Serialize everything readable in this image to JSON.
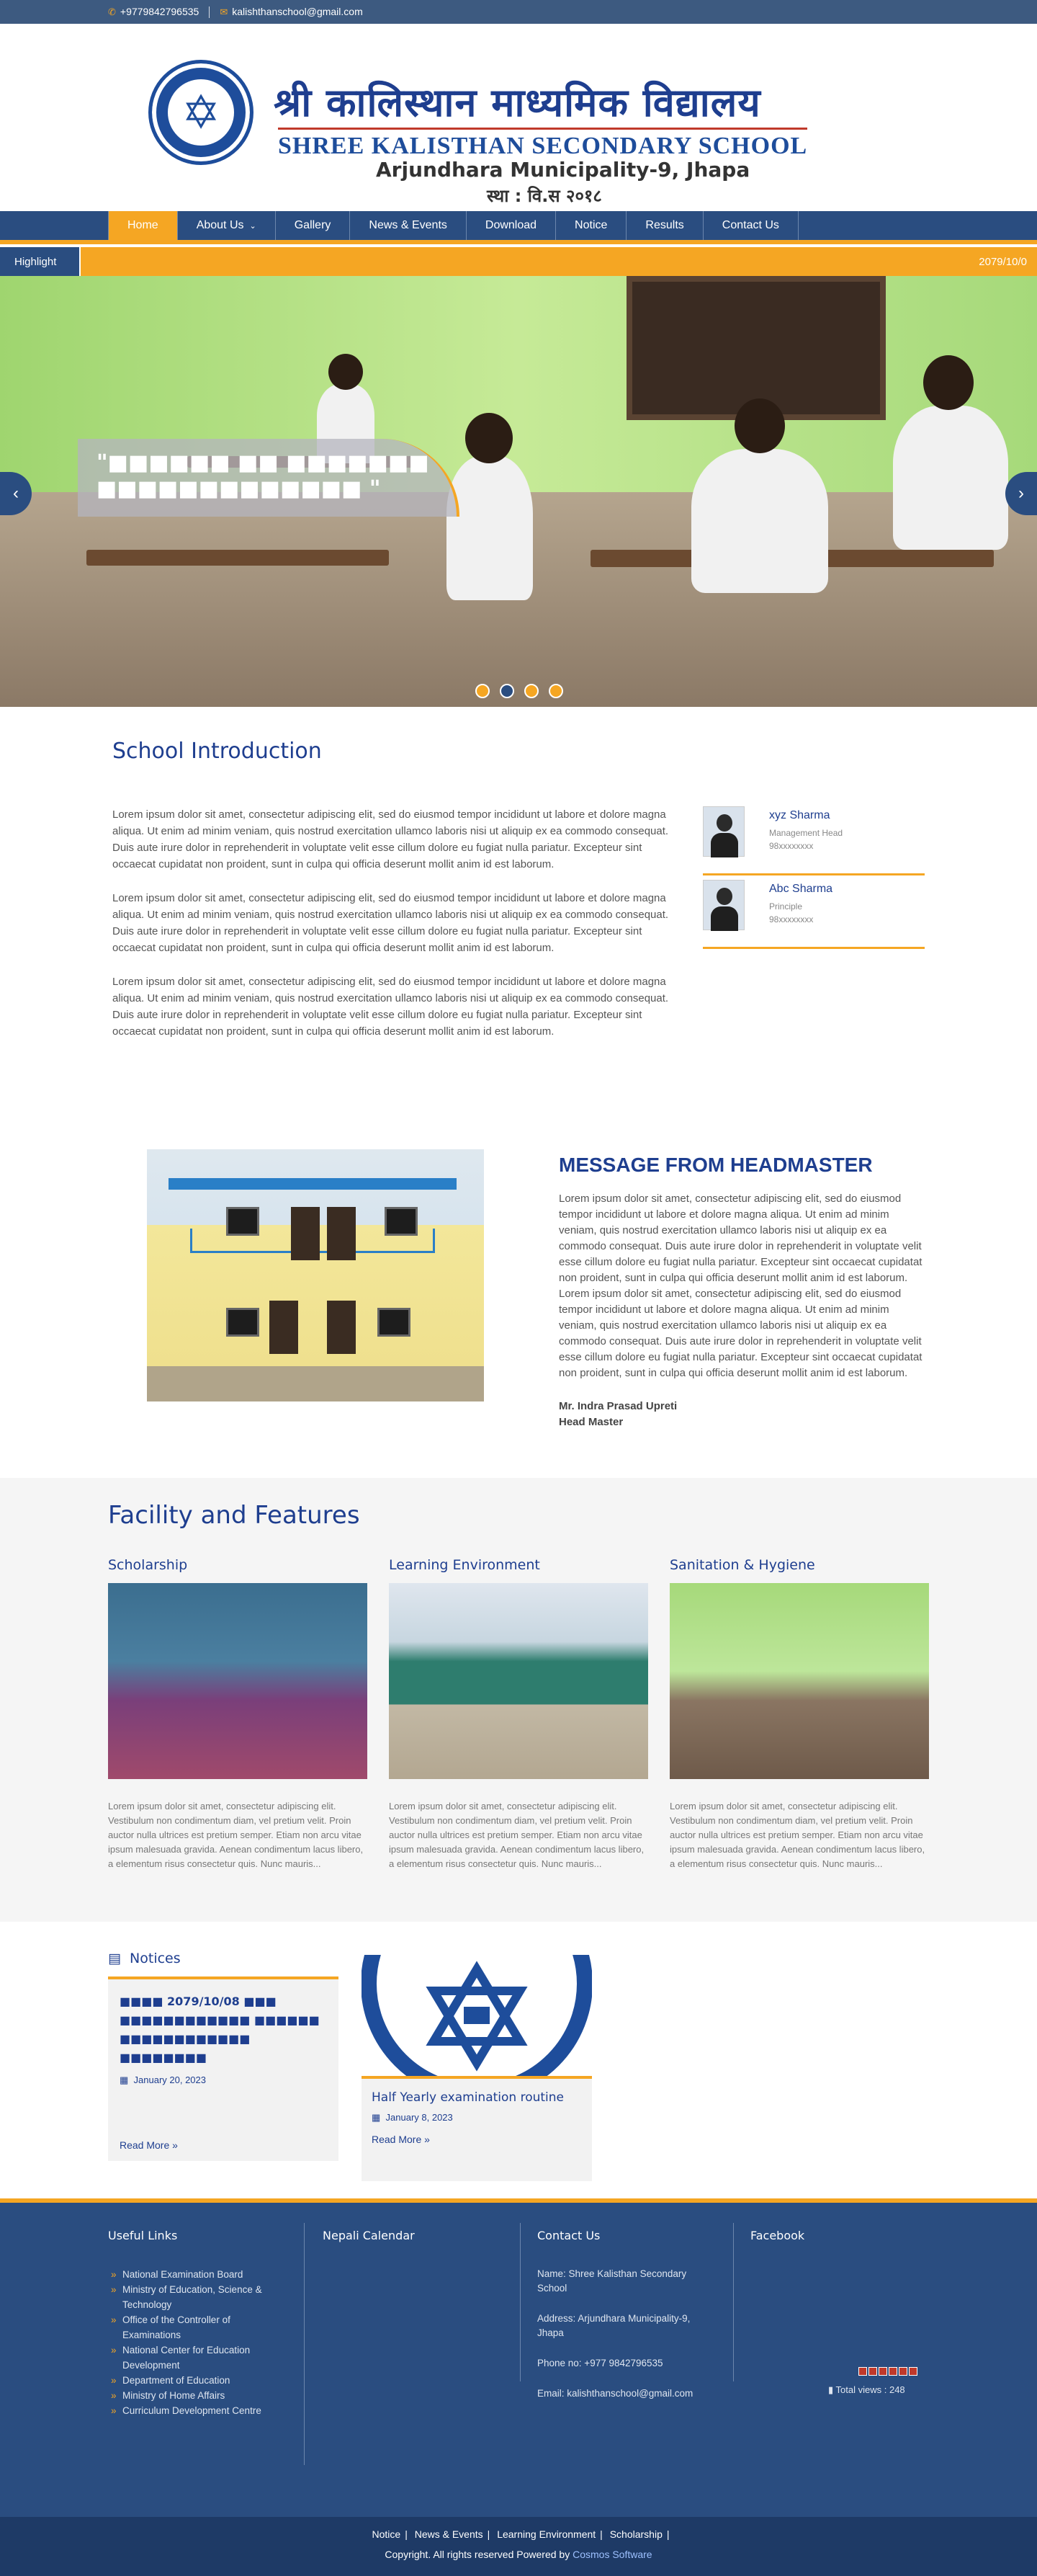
{
  "topbar": {
    "phone": "+9779842796535",
    "email": "kalishthanschool@gmail.com"
  },
  "header": {
    "name_np": "श्री कालिस्थान माध्यमिक विद्यालय",
    "name_en": "SHREE KALISTHAN SECONDARY SCHOOL",
    "address": "Arjundhara Municipality-9, Jhapa",
    "established": "स्था : वि.स २०१८"
  },
  "nav": {
    "items": [
      "Home",
      "About Us",
      "Gallery",
      "News & Events",
      "Download",
      "Notice",
      "Results",
      "Contact Us"
    ],
    "active": "Home"
  },
  "highlight": {
    "label": "Highlight",
    "text": "2079/10/0"
  },
  "slider": {
    "caption": "\"■■■■■■ ■■ ■■■■■■■ ■■■■■■■■■■■■■ \""
  },
  "intro": {
    "title": "School Introduction",
    "paragraphs": [
      "Lorem ipsum dolor sit amet, consectetur adipiscing elit, sed do eiusmod tempor incididunt ut labore et dolore magna aliqua. Ut enim ad minim veniam, quis nostrud exercitation ullamco laboris nisi ut aliquip ex ea commodo consequat. Duis aute irure dolor in reprehenderit in voluptate velit esse cillum dolore eu fugiat nulla pariatur. Excepteur sint occaecat cupidatat non proident, sunt in culpa qui officia deserunt mollit anim id est laborum.",
      "Lorem ipsum dolor sit amet, consectetur adipiscing elit, sed do eiusmod tempor incididunt ut labore et dolore magna aliqua. Ut enim ad minim veniam, quis nostrud exercitation ullamco laboris nisi ut aliquip ex ea commodo consequat. Duis aute irure dolor in reprehenderit in voluptate velit esse cillum dolore eu fugiat nulla pariatur. Excepteur sint occaecat cupidatat non proident, sunt in culpa qui officia deserunt mollit anim id est laborum.",
      "Lorem ipsum dolor sit amet, consectetur adipiscing elit, sed do eiusmod tempor incididunt ut labore et dolore magna aliqua. Ut enim ad minim veniam, quis nostrud exercitation ullamco laboris nisi ut aliquip ex ea commodo consequat. Duis aute irure dolor in reprehenderit in voluptate velit esse cillum dolore eu fugiat nulla pariatur. Excepteur sint occaecat cupidatat non proident, sunt in culpa qui officia deserunt mollit anim id est laborum."
    ],
    "staff": [
      {
        "name": "xyz Sharma",
        "role": "Management Head",
        "phone": "98xxxxxxxx"
      },
      {
        "name": "Abc Sharma",
        "role": "Principle",
        "phone": "98xxxxxxxx"
      }
    ]
  },
  "headmaster": {
    "title": "MESSAGE FROM HEADMASTER",
    "text": "Lorem ipsum dolor sit amet, consectetur adipiscing elit, sed do eiusmod tempor incididunt ut labore et dolore magna aliqua. Ut enim ad minim veniam, quis nostrud exercitation ullamco laboris nisi ut aliquip ex ea commodo consequat. Duis aute irure dolor in reprehenderit in voluptate velit esse cillum dolore eu fugiat nulla pariatur. Excepteur sint occaecat cupidatat non proident, sunt in culpa qui officia deserunt mollit anim id est laborum. Lorem ipsum dolor sit amet, consectetur adipiscing elit, sed do eiusmod tempor incididunt ut labore et dolore magna aliqua. Ut enim ad minim veniam, quis nostrud exercitation ullamco laboris nisi ut aliquip ex ea commodo consequat. Duis aute irure dolor in reprehenderit in voluptate velit esse cillum dolore eu fugiat nulla pariatur. Excepteur sint occaecat cupidatat non proident, sunt in culpa qui officia deserunt mollit anim id est laborum.",
    "name": "Mr. Indra Prasad Upreti",
    "post": "Head Master"
  },
  "facilities": {
    "title": "Facility and Features",
    "items": [
      {
        "title": "Scholarship",
        "text": "Lorem ipsum dolor sit amet, consectetur adipiscing elit. Vestibulum non condimentum diam, vel pretium velit. Proin auctor nulla ultrices est pretium semper. Etiam non arcu vitae ipsum malesuada gravida. Aenean condimentum lacus libero, a elementum risus consectetur quis. Nunc mauris..."
      },
      {
        "title": "Learning Environment",
        "text": "Lorem ipsum dolor sit amet, consectetur adipiscing elit. Vestibulum non condimentum diam, vel pretium velit. Proin auctor nulla ultrices est pretium semper. Etiam non arcu vitae ipsum malesuada gravida. Aenean condimentum lacus libero, a elementum risus consectetur quis. Nunc mauris..."
      },
      {
        "title": "Sanitation & Hygiene",
        "text": "Lorem ipsum dolor sit amet, consectetur adipiscing elit. Vestibulum non condimentum diam, vel pretium velit. Proin auctor nulla ultrices est pretium semper. Etiam non arcu vitae ipsum malesuada gravida. Aenean condimentum lacus libero, a elementum risus consectetur quis. Nunc mauris..."
      }
    ]
  },
  "notices": {
    "title": "Notices",
    "cards": [
      {
        "title": "■■■■ 2079/10/08 ■■■ ■■■■■■■■■■■■ ■■■■■■ ■■■■■■■■■■■■ ■■■■■■■■",
        "date": "January 20, 2023",
        "more": "Read More »"
      },
      {
        "title": "Half Yearly examination routine",
        "date": "January 8, 2023",
        "more": "Read More »"
      }
    ]
  },
  "footer": {
    "useful_links_title": "Useful Links",
    "useful_links": [
      "National Examination Board",
      "Ministry of Education, Science & Technology",
      "Office of the Controller of Examinations",
      "National Center for Education Development",
      "Department of Education",
      "Ministry of Home Affairs",
      "Curriculum Development Centre"
    ],
    "calendar_title": "Nepali Calendar",
    "contact_title": "Contact Us",
    "contact": [
      "Name: Shree Kalisthan Secondary School",
      "Address: Arjundhara Municipality-9, Jhapa",
      "Phone no: +977 9842796535",
      "Email: kalishthanschool@gmail.com"
    ],
    "facebook_title": "Facebook",
    "total_views": "Total views : 248"
  },
  "bottom": {
    "links": [
      "Notice",
      "News & Events",
      "Learning Environment",
      "Scholarship"
    ],
    "copyright": "Copyright. All rights reserved Powered by",
    "brand": "Cosmos Software"
  }
}
